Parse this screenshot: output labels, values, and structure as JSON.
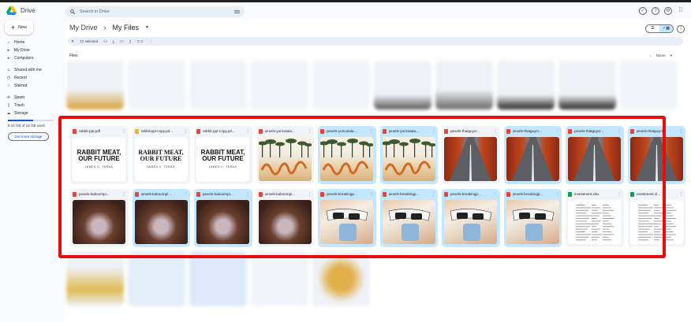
{
  "app": {
    "name": "Drive"
  },
  "search": {
    "placeholder": "Search in Drive"
  },
  "sidebar": {
    "new_label": "New",
    "items": [
      {
        "label": "Home",
        "icon": "home-icon"
      },
      {
        "label": "My Drive",
        "icon": "drive-icon"
      },
      {
        "label": "Computers",
        "icon": "computer-icon"
      },
      {
        "label": "Shared with me",
        "icon": "people-icon"
      },
      {
        "label": "Recent",
        "icon": "clock-icon"
      },
      {
        "label": "Starred",
        "icon": "star-icon"
      },
      {
        "label": "Spam",
        "icon": "spam-icon"
      },
      {
        "label": "Trash",
        "icon": "trash-icon"
      },
      {
        "label": "Storage",
        "icon": "cloud-icon"
      }
    ],
    "storage_text": "8.44 GB of 15 GB used",
    "storage_used_fraction": 0.56,
    "storage_button": "Get more storage"
  },
  "breadcrumb": {
    "root": "My Drive",
    "separator": "›",
    "current": "My Files"
  },
  "selection": {
    "count_label": "12 selected"
  },
  "files_label": "Files",
  "sort_label": "Name",
  "colors": {
    "accent": "#0b57d0",
    "selected": "#c2e7ff",
    "highlight": "#e90c0c"
  },
  "files": [
    {
      "name": "rabbit-ppt.pdf",
      "type": "pdf",
      "selected": false,
      "thumb": "doc-sans",
      "title": "RABBIT MEAT, OUR FUTURE",
      "author": "JAMES C. TERAS"
    },
    {
      "name": "rabbit-ppt-copy.pd...",
      "type": "slides",
      "selected": false,
      "thumb": "doc-serif",
      "title": "RABBIT MEAT, OUR FUTURE",
      "author": "JAMES C. TERAS"
    },
    {
      "name": "rabbit-ppt-copy.pd...",
      "type": "pdf",
      "selected": false,
      "thumb": "doc-sans",
      "title": "RABBIT MEAT, OUR FUTURE",
      "author": "JAMES C. TERAS"
    },
    {
      "name": "pexels-yuricatala...",
      "type": "img",
      "selected": false,
      "thumb": "beach"
    },
    {
      "name": "pexels-yuricatala...",
      "type": "img",
      "selected": true,
      "thumb": "beach"
    },
    {
      "name": "pexels-yuricatala...",
      "type": "img",
      "selected": true,
      "thumb": "beach"
    },
    {
      "name": "pexels-thatguycr...",
      "type": "img",
      "selected": false,
      "thumb": "road"
    },
    {
      "name": "pexels-thatguycr...",
      "type": "img",
      "selected": true,
      "thumb": "road"
    },
    {
      "name": "pexels-thatguycr...",
      "type": "img",
      "selected": true,
      "thumb": "road"
    },
    {
      "name": "pexels-thatguycr...",
      "type": "img",
      "selected": true,
      "thumb": "road"
    },
    {
      "name": "pexels-kaboompi...",
      "type": "img",
      "selected": false,
      "thumb": "hand"
    },
    {
      "name": "pexels-kaboompi...",
      "type": "img",
      "selected": true,
      "thumb": "hand"
    },
    {
      "name": "pexels-kaboompi...",
      "type": "img",
      "selected": true,
      "thumb": "hand"
    },
    {
      "name": "pexels-kaboompi...",
      "type": "img",
      "selected": false,
      "thumb": "hand"
    },
    {
      "name": "pexels-breakingp...",
      "type": "img",
      "selected": true,
      "thumb": "phone"
    },
    {
      "name": "pexels-breakingp...",
      "type": "img",
      "selected": true,
      "thumb": "phone"
    },
    {
      "name": "pexels-breakingp...",
      "type": "img",
      "selected": true,
      "thumb": "phone"
    },
    {
      "name": "pexels-breakingp...",
      "type": "img",
      "selected": true,
      "thumb": "phone"
    },
    {
      "name": "investment.xlsx",
      "type": "xls",
      "selected": false,
      "thumb": "sheet"
    },
    {
      "name": "investment.xl...",
      "type": "xls",
      "selected": false,
      "thumb": "sheet"
    }
  ]
}
